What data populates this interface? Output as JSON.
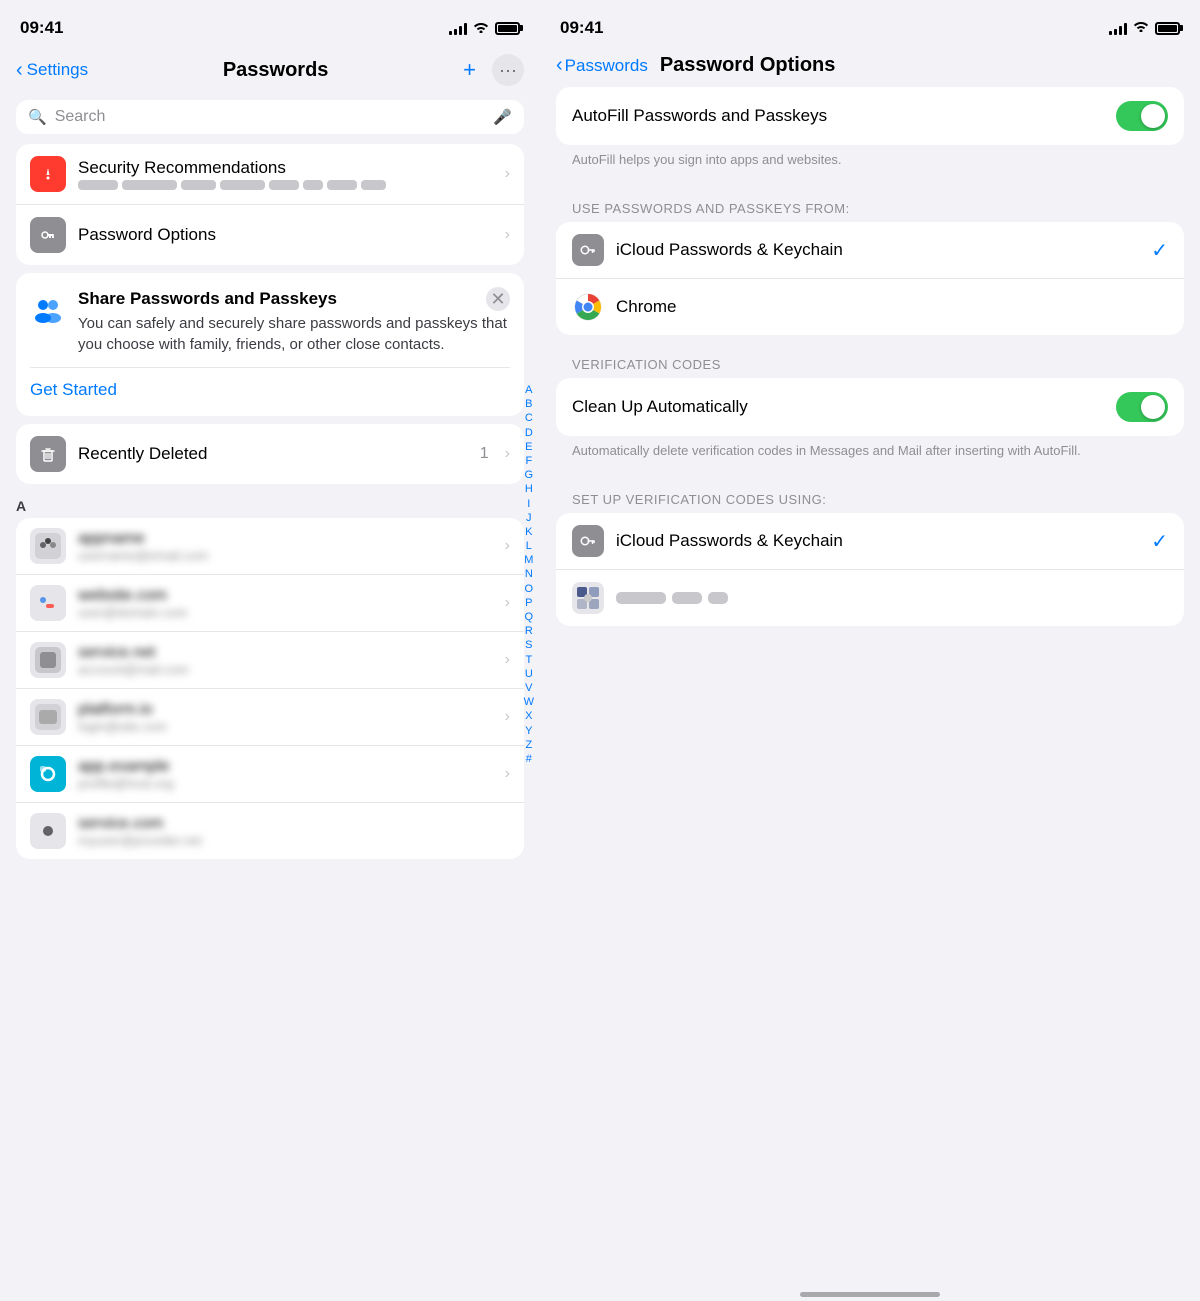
{
  "left": {
    "statusBar": {
      "time": "09:41",
      "signal": [
        3,
        5,
        7,
        9,
        11
      ],
      "battery": 100
    },
    "navBar": {
      "backLabel": "Settings",
      "title": "Passwords",
      "addLabel": "+",
      "moreLabel": "···"
    },
    "searchBar": {
      "placeholder": "Search",
      "micLabel": "microphone"
    },
    "listItems": [
      {
        "id": "security-recommendations",
        "title": "Security Recommendations",
        "iconType": "red",
        "iconLabel": "warning-icon",
        "hasChevron": true
      },
      {
        "id": "password-options",
        "title": "Password Options",
        "iconType": "gray",
        "iconLabel": "password-options-icon",
        "hasChevron": true
      }
    ],
    "shareCard": {
      "title": "Share Passwords and Passkeys",
      "body": "You can safely and securely share passwords and passkeys that you choose with family, friends, or other close contacts.",
      "cta": "Get Started"
    },
    "recentlyDeleted": {
      "title": "Recently Deleted",
      "badge": "1",
      "hasChevron": true
    },
    "sectionHeader": "A",
    "alphabetIndex": [
      "A",
      "B",
      "C",
      "D",
      "E",
      "F",
      "G",
      "H",
      "I",
      "J",
      "K",
      "L",
      "M",
      "N",
      "O",
      "P",
      "Q",
      "R",
      "S",
      "T",
      "U",
      "V",
      "W",
      "X",
      "Y",
      "Z",
      "#"
    ]
  },
  "right": {
    "statusBar": {
      "time": "09:41"
    },
    "navBar": {
      "backLabel": "Passwords",
      "title": "Password Options"
    },
    "autofill": {
      "label": "AutoFill Passwords and Passkeys",
      "enabled": true,
      "description": "AutoFill helps you sign into apps and websites."
    },
    "sectionUseFrom": "USE PASSWORDS AND PASSKEYS FROM:",
    "passwordSources": [
      {
        "id": "icloud-passwords",
        "label": "iCloud Passwords & Keychain",
        "iconType": "key",
        "checked": true
      },
      {
        "id": "chrome",
        "label": "Chrome",
        "iconType": "chrome",
        "checked": false
      }
    ],
    "verificationCodes": {
      "sectionLabel": "VERIFICATION CODES",
      "cleanUpLabel": "Clean Up Automatically",
      "cleanUpEnabled": true,
      "cleanUpDescription": "Automatically delete verification codes in Messages and Mail after inserting with AutoFill.",
      "setupLabel": "SET UP VERIFICATION CODES USING:",
      "sources": [
        {
          "id": "icloud-verification",
          "label": "iCloud Passwords & Keychain",
          "iconType": "key",
          "checked": true
        },
        {
          "id": "other-verification",
          "label": "",
          "iconType": "puzzle",
          "checked": false
        }
      ]
    }
  }
}
